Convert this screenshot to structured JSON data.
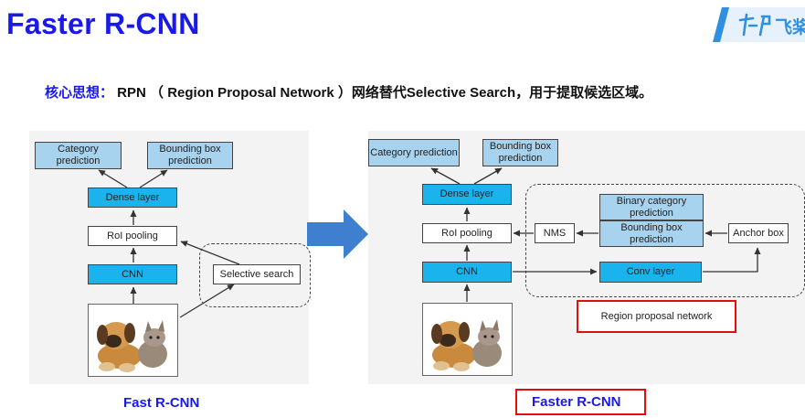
{
  "slide": {
    "title": "Faster R-CNN",
    "logo_text": "飞桨",
    "subtitle_keyword": "核心思想：",
    "subtitle_text": " RPN （ Region Proposal Network ）网络替代Selective Search，用于提取候选区域。"
  },
  "fast_rcnn": {
    "caption": "Fast R-CNN",
    "category": "Category prediction",
    "bbox": "Bounding box prediction",
    "dense": "Dense layer",
    "roi": "RoI pooling",
    "cnn": "CNN",
    "selective": "Selective search"
  },
  "faster_rcnn": {
    "caption": "Faster R-CNN",
    "category": "Category prediction",
    "bbox": "Bounding box prediction",
    "dense": "Dense layer",
    "roi": "RoI pooling",
    "cnn": "CNN",
    "nms": "NMS",
    "binary": "Binary category prediction",
    "rpn_bbox": "Bounding box prediction",
    "anchor": "Anchor box",
    "conv": "Conv layer",
    "rpn_label": "Region proposal network"
  },
  "colors": {
    "title_blue": "#1a1ae6",
    "light_box": "#a8d3ef",
    "dark_box": "#1ab3ee",
    "arrow_blue": "#3f7fd0",
    "highlight_red": "#e01010"
  },
  "icons": [
    "logo-icon",
    "transition-arrow-icon",
    "dog-cat-photo"
  ]
}
